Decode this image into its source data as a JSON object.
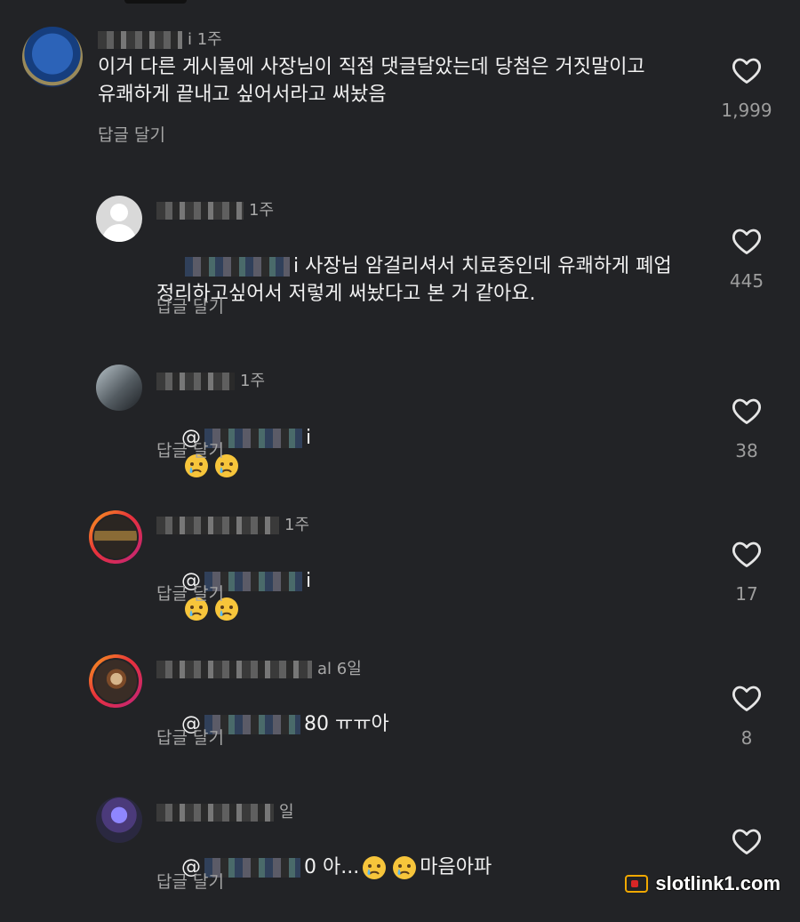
{
  "comments": [
    {
      "meta_suffix": "i 1주",
      "text": "이거 다른 게시물에 사장님이 직접 댓글달았는데 당첨은 거짓말이고\n유쾌하게 끝내고 싶어서라고 써놨음",
      "reply": "답글 달기",
      "likes": "1,999"
    },
    {
      "meta_suffix": "1주",
      "mention": "i",
      "text": "사장님 암걸리셔서 치료중인데 유쾌하게 폐업\n정리하고싶어서 저렇게 써놨다고 본 거 같아요.",
      "reply": "답글 달기",
      "likes": "445"
    },
    {
      "meta_suffix": "1주",
      "mention": "@",
      "mention_tail": "i",
      "reply": "답글 달기",
      "likes": "38"
    },
    {
      "meta_suffix": "1주",
      "mention": "@",
      "mention_tail": "i",
      "reply": "답글 달기",
      "likes": "17"
    },
    {
      "meta_suffix": "al 6일",
      "mention": "@",
      "mention_tail": "80",
      "text": "ㅠㅠ아",
      "reply": "답글 달기",
      "likes": "8"
    },
    {
      "meta_suffix": "일",
      "mention": "@",
      "mention_tail": "0",
      "text_before": "아...",
      "text_after": "마음아파",
      "reply": "답글 달기",
      "likes": ""
    }
  ],
  "icons": {
    "heart": "heart-icon",
    "crying": "crying-face-emoji"
  },
  "watermark": {
    "brand": "slotlink1.com"
  },
  "colors": {
    "background": "#222326",
    "secondary": "#a5a5a5"
  }
}
